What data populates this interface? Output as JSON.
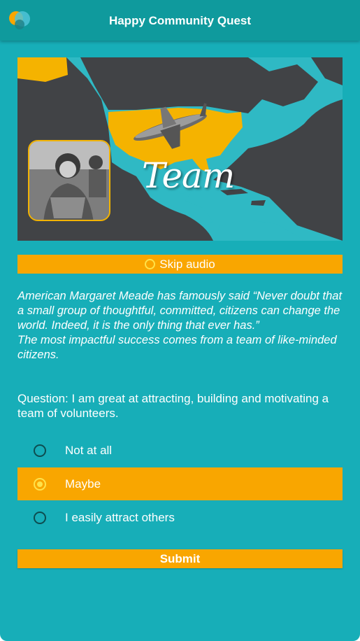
{
  "header": {
    "title": "Happy Community Quest",
    "logo_icon": "app-logo-icon"
  },
  "hero": {
    "overlay_text": "Team",
    "colors": {
      "land_highlight": "#f5b300",
      "water": "#2fb9c4",
      "background": "#414346"
    }
  },
  "skip_audio": {
    "label": "Skip audio",
    "icon": "record-ring-icon"
  },
  "quote": {
    "paragraph1": "American Margaret Meade has famously said “Never doubt that a small group of thoughtful, committed, citizens can change the world. Indeed, it is the only thing that ever has.”",
    "paragraph2": "The most impactful success comes from a team of like-minded citizens."
  },
  "question": {
    "text": "Question: I am great at attracting, building and motivating a team of volunteers."
  },
  "options": [
    {
      "label": "Not at all",
      "selected": false
    },
    {
      "label": "Maybe",
      "selected": true
    },
    {
      "label": "I easily attract others",
      "selected": false
    }
  ],
  "submit": {
    "label": "Submit"
  },
  "colors": {
    "primary": "#17aeb8",
    "appbar": "#0f9a9d",
    "accent": "#f9a600"
  }
}
